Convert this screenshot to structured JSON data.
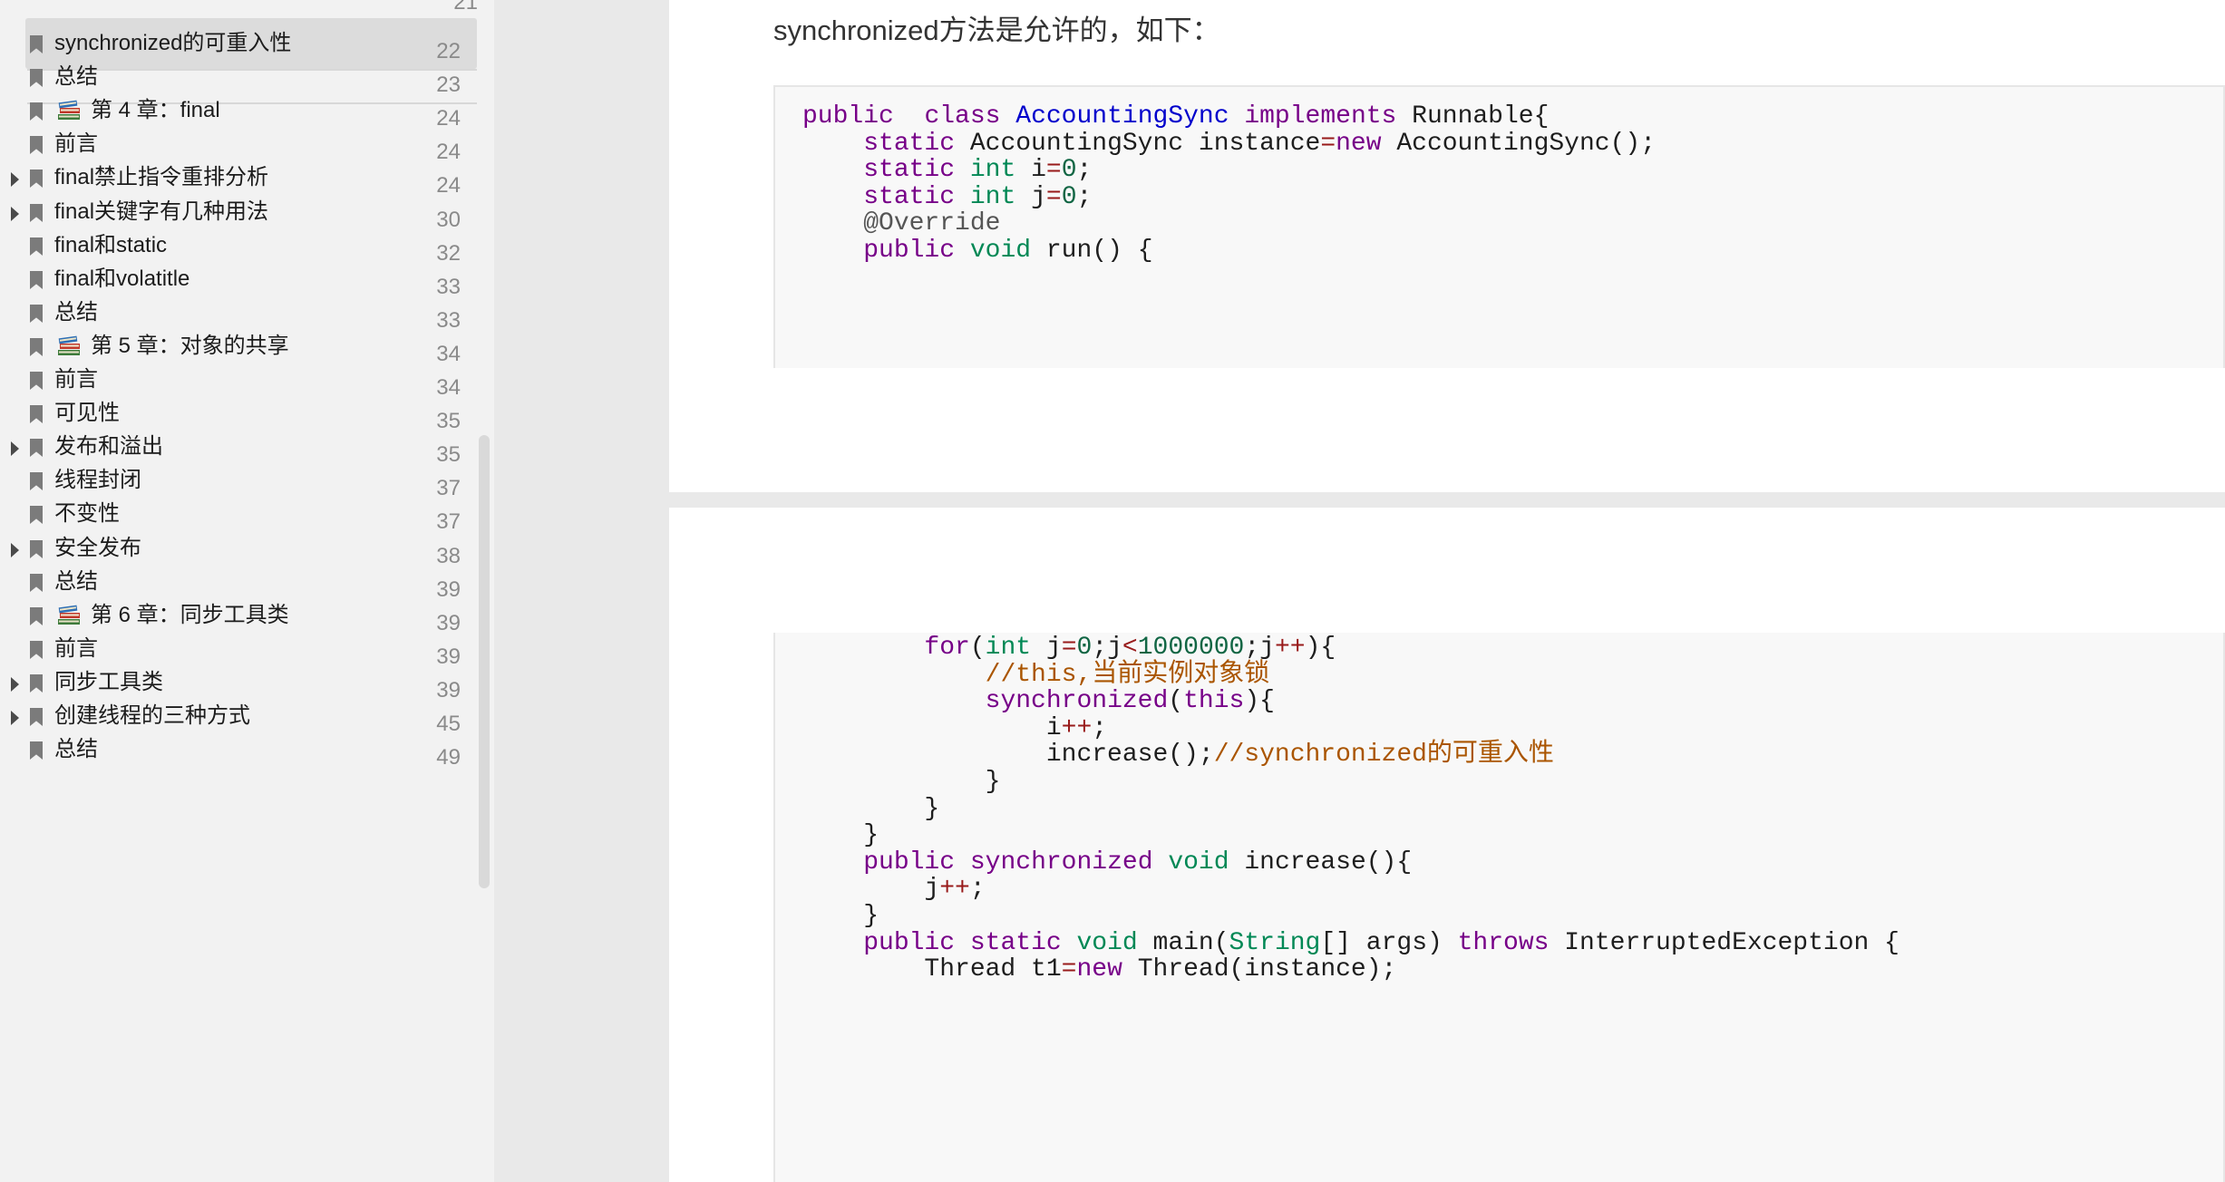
{
  "toc": {
    "items": [
      {
        "label": "synchronized的可重入性",
        "page": "22",
        "expandable": false,
        "chapter": false,
        "selected": true
      },
      {
        "label": "总结",
        "page": "23",
        "expandable": false,
        "chapter": false,
        "selected": false
      },
      {
        "label": "第 4 章：final",
        "page": "24",
        "expandable": false,
        "chapter": true,
        "selected": false
      },
      {
        "label": "前言",
        "page": "24",
        "expandable": false,
        "chapter": false,
        "selected": false
      },
      {
        "label": "final禁止指令重排分析",
        "page": "24",
        "expandable": true,
        "chapter": false,
        "selected": false
      },
      {
        "label": "final关键字有几种用法",
        "page": "30",
        "expandable": true,
        "chapter": false,
        "selected": false
      },
      {
        "label": "final和static",
        "page": "32",
        "expandable": false,
        "chapter": false,
        "selected": false
      },
      {
        "label": "final和volatitle",
        "page": "33",
        "expandable": false,
        "chapter": false,
        "selected": false
      },
      {
        "label": "总结",
        "page": "33",
        "expandable": false,
        "chapter": false,
        "selected": false
      },
      {
        "label": "第 5 章：对象的共享",
        "page": "34",
        "expandable": false,
        "chapter": true,
        "selected": false
      },
      {
        "label": "前言",
        "page": "34",
        "expandable": false,
        "chapter": false,
        "selected": false
      },
      {
        "label": "可见性",
        "page": "35",
        "expandable": false,
        "chapter": false,
        "selected": false
      },
      {
        "label": "发布和溢出",
        "page": "35",
        "expandable": true,
        "chapter": false,
        "selected": false
      },
      {
        "label": "线程封闭",
        "page": "37",
        "expandable": false,
        "chapter": false,
        "selected": false
      },
      {
        "label": "不变性",
        "page": "37",
        "expandable": false,
        "chapter": false,
        "selected": false
      },
      {
        "label": "安全发布",
        "page": "38",
        "expandable": true,
        "chapter": false,
        "selected": false
      },
      {
        "label": "总结",
        "page": "39",
        "expandable": false,
        "chapter": false,
        "selected": false
      },
      {
        "label": "第 6 章：同步工具类",
        "page": "39",
        "expandable": false,
        "chapter": true,
        "selected": false
      },
      {
        "label": "前言",
        "page": "39",
        "expandable": false,
        "chapter": false,
        "selected": false
      },
      {
        "label": "同步工具类",
        "page": "39",
        "expandable": true,
        "chapter": false,
        "selected": false
      },
      {
        "label": "创建线程的三种方式",
        "page": "45",
        "expandable": true,
        "chapter": false,
        "selected": false
      },
      {
        "label": "总结",
        "page": "49",
        "expandable": false,
        "chapter": false,
        "selected": false
      }
    ],
    "partial_top_page": "21"
  },
  "document": {
    "page_top": {
      "paragraph": "synchronized方法是允许的，如下：",
      "code_lines": [
        [
          [
            "kw",
            "public"
          ],
          [
            "",
            "  "
          ],
          [
            "kw",
            "class"
          ],
          [
            "",
            " "
          ],
          [
            "cls",
            "AccountingSync"
          ],
          [
            "",
            " "
          ],
          [
            "kw",
            "implements"
          ],
          [
            "",
            " Runnable{"
          ]
        ],
        [
          [
            "",
            "    "
          ],
          [
            "kw",
            "static"
          ],
          [
            "",
            " AccountingSync instance"
          ],
          [
            "op",
            "="
          ],
          [
            "kw",
            "new"
          ],
          [
            "",
            " AccountingSync();"
          ]
        ],
        [
          [
            "",
            "    "
          ],
          [
            "kw",
            "static"
          ],
          [
            "",
            " "
          ],
          [
            "ty",
            "int"
          ],
          [
            "",
            " i"
          ],
          [
            "op",
            "="
          ],
          [
            "num",
            "0"
          ],
          [
            "",
            ";"
          ]
        ],
        [
          [
            "",
            "    "
          ],
          [
            "kw",
            "static"
          ],
          [
            "",
            " "
          ],
          [
            "ty",
            "int"
          ],
          [
            "",
            " j"
          ],
          [
            "op",
            "="
          ],
          [
            "num",
            "0"
          ],
          [
            "",
            ";"
          ]
        ],
        [
          [
            "",
            "    "
          ],
          [
            "meta",
            "@Override"
          ]
        ],
        [
          [
            "",
            "    "
          ],
          [
            "kw",
            "public"
          ],
          [
            "",
            " "
          ],
          [
            "ty",
            "void"
          ],
          [
            "",
            " run() {"
          ]
        ]
      ]
    },
    "page_bottom": {
      "code_lines": [
        [
          [
            "",
            "        "
          ],
          [
            "kw",
            "for"
          ],
          [
            "",
            "("
          ],
          [
            "ty",
            "int"
          ],
          [
            "",
            " j"
          ],
          [
            "op",
            "="
          ],
          [
            "num",
            "0"
          ],
          [
            "",
            ";j"
          ],
          [
            "op",
            "<"
          ],
          [
            "num",
            "1000000"
          ],
          [
            "",
            ";j"
          ],
          [
            "op",
            "++"
          ],
          [
            "",
            "){"
          ]
        ],
        [
          [
            "",
            "            "
          ],
          [
            "cm",
            "//this,当前实例对象锁"
          ]
        ],
        [
          [
            "",
            "            "
          ],
          [
            "kw",
            "synchronized"
          ],
          [
            "",
            "("
          ],
          [
            "kw",
            "this"
          ],
          [
            "",
            "){"
          ]
        ],
        [
          [
            "",
            "                i"
          ],
          [
            "op",
            "++"
          ],
          [
            "",
            ";"
          ]
        ],
        [
          [
            "",
            "                increase();"
          ],
          [
            "cm",
            "//synchronized的可重入性"
          ]
        ],
        [
          [
            "",
            "            }"
          ]
        ],
        [
          [
            "",
            "        }"
          ]
        ],
        [
          [
            "",
            "    }"
          ]
        ],
        [
          [
            "",
            "    "
          ],
          [
            "kw",
            "public"
          ],
          [
            "",
            " "
          ],
          [
            "kw",
            "synchronized"
          ],
          [
            "",
            " "
          ],
          [
            "ty",
            "void"
          ],
          [
            "",
            " increase(){"
          ]
        ],
        [
          [
            "",
            "        j"
          ],
          [
            "op",
            "++"
          ],
          [
            "",
            ";"
          ]
        ],
        [
          [
            "",
            "    }"
          ]
        ],
        [
          [
            "",
            "    "
          ],
          [
            "kw",
            "public"
          ],
          [
            "",
            " "
          ],
          [
            "kw",
            "static"
          ],
          [
            "",
            " "
          ],
          [
            "ty",
            "void"
          ],
          [
            "",
            " main("
          ],
          [
            "ty",
            "String"
          ],
          [
            "",
            "[] args) "
          ],
          [
            "kw",
            "throws"
          ],
          [
            "",
            " InterruptedException {"
          ]
        ],
        [
          [
            "",
            "        Thread t1"
          ],
          [
            "op",
            "="
          ],
          [
            "kw",
            "new"
          ],
          [
            "",
            " Thread(instance);"
          ]
        ]
      ]
    }
  }
}
